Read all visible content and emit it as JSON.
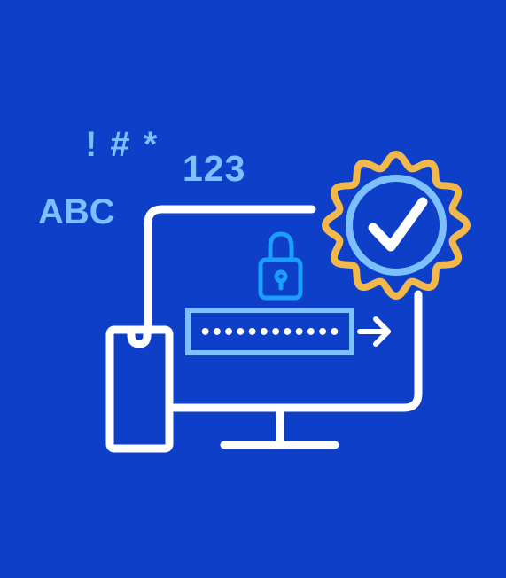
{
  "palette": {
    "background": "#0d3fc8",
    "accent_light_blue": "#7cc0ff",
    "accent_blue": "#1a9fff",
    "badge_gold": "#f2b84b",
    "line_white": "#ffffff"
  },
  "labels": {
    "symbols": "! # *",
    "numbers": "123",
    "letters": "ABC",
    "password_mask": "••••••••••••"
  },
  "icons": [
    "desktop-monitor-icon",
    "mobile-phone-icon",
    "padlock-icon",
    "password-field-icon",
    "arrow-right-icon",
    "verified-badge-icon",
    "checkmark-icon"
  ]
}
